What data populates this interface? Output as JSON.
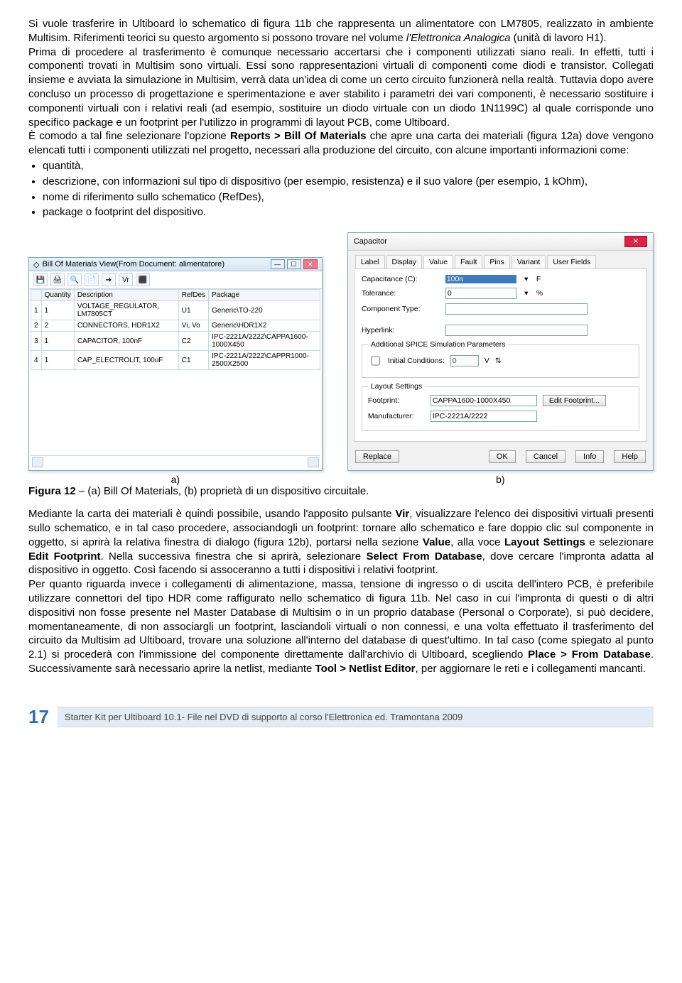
{
  "para1_a": "Si vuole trasferire in Ultiboard lo schematico di figura 11b che rappresenta un alimentatore con LM7805, realizzato in ambiente Multisim. Riferimenti teorici su questo argomento si possono trovare nel volume ",
  "para1_b": "l'Elettronica Analogica",
  "para1_c": " (unità di lavoro H1).",
  "para2": "Prima di procedere al trasferimento è comunque necessario accertarsi che i componenti utilizzati siano reali. In effetti, tutti i componenti trovati in Multisim sono virtuali. Essi sono rappresentazioni virtuali di componenti come diodi e transistor. Collegati insieme e avviata la simulazione in Multisim, verrà data un'idea di come un certo circuito funzionerà nella realtà. Tuttavia dopo avere concluso un processo di progettazione e sperimentazione e aver stabilito i parametri dei vari componenti, è necessario sostituire i componenti virtuali con i relativi reali (ad esempio, sostituire un diodo virtuale con un diodo 1N1199C) al quale corrisponde uno specifico package e un footprint per l'utilizzo in programmi di layout PCB, come Ultiboard.",
  "para3_a": "È comodo a tal fine selezionare l'opzione ",
  "para3_b": "Reports > Bill Of Materials",
  "para3_c": " che apre una carta dei materiali (figura 12a) dove vengono elencati tutti i componenti utilizzati nel progetto, necessari alla produzione del circuito, con alcune importanti informazioni come:",
  "bullets": {
    "b1": "quantità,",
    "b2": "descrizione, con informazioni sul tipo di dispositivo (per esempio, resistenza) e il suo valore (per esempio, 1 kOhm),",
    "b3": "nome di riferimento sullo schematico (RefDes),",
    "b4": "package o footprint del dispositivo."
  },
  "figA": {
    "title": "Bill Of Materials View(From Document: alimentatore)",
    "tool_vr": "Vr",
    "headers": {
      "h0": "",
      "h1": "Quantity",
      "h2": "Description",
      "h3": "RefDes",
      "h4": "Package"
    },
    "rows": [
      {
        "n": "1",
        "q": "1",
        "d": "VOLTAGE_REGULATOR, LM7805CT",
        "r": "U1",
        "p": "Generic\\TO-220"
      },
      {
        "n": "2",
        "q": "2",
        "d": "CONNECTORS, HDR1X2",
        "r": "Vi, Vo",
        "p": "Generic\\HDR1X2"
      },
      {
        "n": "3",
        "q": "1",
        "d": "CAPACITOR, 100nF",
        "r": "C2",
        "p": "IPC-2221A/2222\\CAPPA1600-1000X450"
      },
      {
        "n": "4",
        "q": "1",
        "d": "CAP_ELECTROLIT, 100uF",
        "r": "C1",
        "p": "IPC-2221A/2222\\CAPPR1000-2500X2500"
      }
    ]
  },
  "figB": {
    "title": "Capacitor",
    "tabs": {
      "t1": "Label",
      "t2": "Display",
      "t3": "Value",
      "t4": "Fault",
      "t5": "Pins",
      "t6": "Variant",
      "t7": "User Fields"
    },
    "rows": {
      "cap_label": "Capacitance (C):",
      "cap_value": "100n",
      "cap_unit": "F",
      "tol_label": "Tolerance:",
      "tol_value": "0",
      "tol_unit": "%",
      "comp_label": "Component Type:",
      "hyper_label": "Hyperlink:"
    },
    "spice": {
      "legend": "Additional SPICE Simulation Parameters",
      "init_label": "Initial Conditions:",
      "init_val": "0",
      "init_unit": "V"
    },
    "layout": {
      "legend": "Layout Settings",
      "foot_label": "Footprint:",
      "foot_val": "CAPPA1600-1000X450",
      "editfoot": "Edit Footprint...",
      "manu_label": "Manufacturer:",
      "manu_val": "IPC-2221A/2222"
    },
    "buttons": {
      "replace": "Replace",
      "ok": "OK",
      "cancel": "Cancel",
      "info": "Info",
      "help": "Help"
    }
  },
  "cap_a": "a)",
  "cap_b": "b)",
  "figcaption_a": "Figura 12",
  "figcaption_b": " – (a) Bill Of Materials, (b) proprietà di un dispositivo circuitale.",
  "para4_a": "Mediante la carta dei materiali è quindi possibile, usando l'apposito pulsante ",
  "para4_vir": "Vir",
  "para4_b": ", visualizzare l'elenco dei dispositivi virtuali presenti sullo schematico, e in tal caso procedere, associandogli un footprint: tornare allo schematico e fare doppio clic sul componente in oggetto, si aprirà la relativa finestra di dialogo (figura 12b), portarsi nella sezione ",
  "para4_value": "Value",
  "para4_c": ", alla voce ",
  "para4_layout": "Layout Settings",
  "para4_d": " e selezionare ",
  "para4_edit": "Edit Footprint",
  "para4_e": ". Nella successiva finestra che si aprirà, selezionare ",
  "para4_select": "Select From Database",
  "para4_f": ", dove cercare l'impronta adatta al dispositivo in oggetto. Così facendo si assoceranno a tutti i dispositivi i relativi footprint.",
  "para5_a": "Per quanto riguarda invece i collegamenti di alimentazione, massa, tensione di ingresso o di uscita dell'intero PCB, è preferibile utilizzare connettori del tipo HDR come raffigurato nello schematico di figura 11b. Nel caso in cui l'impronta di questi o di altri dispositivi non fosse presente nel Master Database di Multisim o in un proprio database (Personal o Corporate), si può decidere, momentaneamente, di non associargli un footprint, lasciandoli virtuali o non connessi, e una volta effettuato il trasferimento del circuito da Multisim ad Ultiboard, trovare una soluzione all'interno del database di quest'ultimo. In tal caso (come spiegato al punto 2.1) si procederà con l'immissione del componente direttamente dall'archivio di Ultiboard, scegliendo ",
  "para5_place": "Place > From Database",
  "para5_b": ". Successivamente sarà necessario aprire la netlist, mediante ",
  "para5_tool": "Tool > Netlist Editor",
  "para5_c": ", per aggiornare le reti e i collegamenti mancanti.",
  "footer": {
    "page": "17",
    "text_a": "Starter Kit per Ultiboard 10.1- File nel DVD di supporto al corso ",
    "text_b": "l'Elettronica",
    "text_c": " ed. Tramontana 2009"
  }
}
